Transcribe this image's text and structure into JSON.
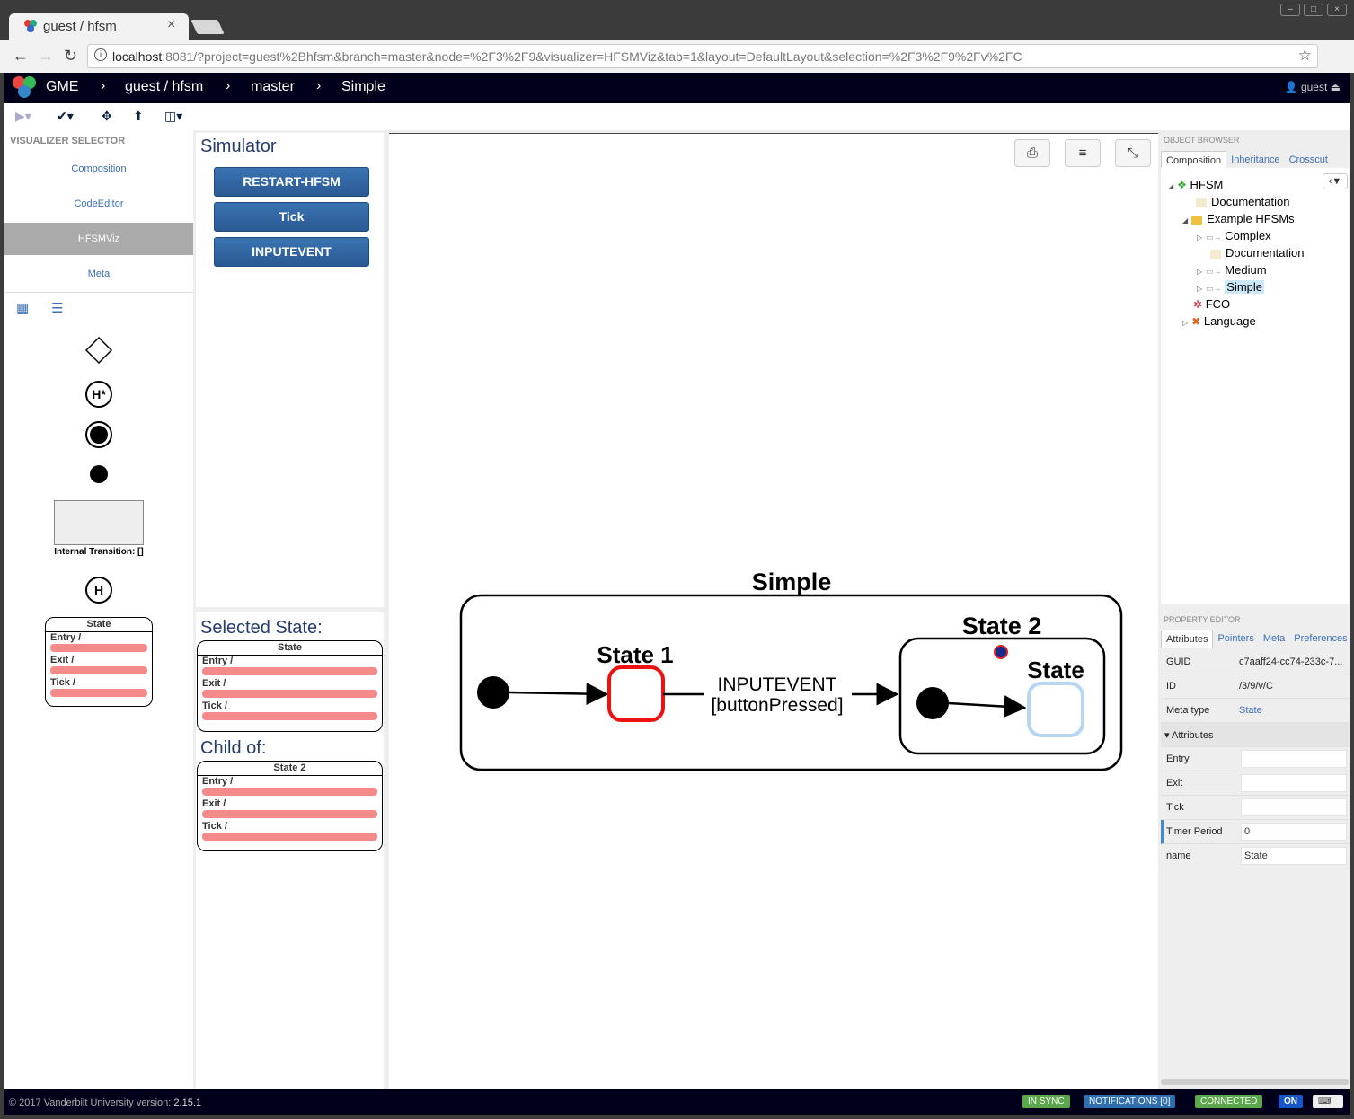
{
  "browser": {
    "tab_title": "guest / hfsm",
    "tab_close": "×",
    "url_host": "localhost",
    "url_rest": ":8081/?project=guest%2Bhfsm&branch=master&node=%2F3%2F9&visualizer=HFSMViz&tab=1&layout=DefaultLayout&selection=%2F3%2F9%2Fv%2FC"
  },
  "navbar": {
    "brand": "GME",
    "crumbs": [
      "guest / hfsm",
      "master",
      "Simple"
    ],
    "user": "guest"
  },
  "visualizer_selector": {
    "title": "VISUALIZER SELECTOR",
    "items": [
      "Composition",
      "CodeEditor",
      "HFSMViz",
      "Meta"
    ],
    "active": "HFSMViz",
    "internal_transition_label": "Internal Transition: []",
    "template_state": {
      "name": "State",
      "entry": "Entry /",
      "exit": "Exit /",
      "tick": "Tick /"
    }
  },
  "simulator": {
    "title": "Simulator",
    "buttons": [
      "RESTART-HFSM",
      "Tick",
      "INPUTEVENT"
    ]
  },
  "selected": {
    "selected_label": "Selected State:",
    "selected_state": {
      "name": "State",
      "entry": "Entry /",
      "exit": "Exit /",
      "tick": "Tick /"
    },
    "child_label": "Child of:",
    "parent_state": {
      "name": "State 2",
      "entry": "Entry /",
      "exit": "Exit /",
      "tick": "Tick /"
    }
  },
  "diagram": {
    "root": "Simple",
    "state1": "State 1",
    "state2": "State 2",
    "inner_state": "State",
    "transition_event": "INPUTEVENT",
    "transition_guard": "[buttonPressed]",
    "colors": {
      "state1_border": "#ee1111",
      "inner_border": "#b7d6f3",
      "accent": "#1f4a7e"
    }
  },
  "object_browser": {
    "title": "OBJECT BROWSER",
    "tabs": [
      "Composition",
      "Inheritance",
      "Crosscut"
    ],
    "tree": {
      "root": "HFSM",
      "documentation": "Documentation",
      "examples": "Example HFSMs",
      "complex": "Complex",
      "ex_documentation": "Documentation",
      "medium": "Medium",
      "simple": "Simple",
      "fco": "FCO",
      "language": "Language"
    }
  },
  "property_editor": {
    "title": "PROPERTY EDITOR",
    "tabs": [
      "Attributes",
      "Pointers",
      "Meta",
      "Preferences"
    ],
    "guid_label": "GUID",
    "guid": "c7aaff24-cc74-233c-7...",
    "id_label": "ID",
    "id": "/3/9/v/C",
    "metatype_label": "Meta type",
    "metatype": "State",
    "attributes_header": "Attributes",
    "entry_label": "Entry",
    "entry": "",
    "exit_label": "Exit",
    "exit": "",
    "tick_label": "Tick",
    "tick": "",
    "timer_label": "Timer Period",
    "timer": "0",
    "name_label": "name",
    "name": "State"
  },
  "footer": {
    "copyright": "© 2017 Vanderbilt University",
    "version_label": "version:",
    "version": "2.15.1",
    "in_sync": "IN SYNC",
    "notifications": "NOTIFICATIONS [0]",
    "connected": "CONNECTED",
    "on": "ON"
  }
}
